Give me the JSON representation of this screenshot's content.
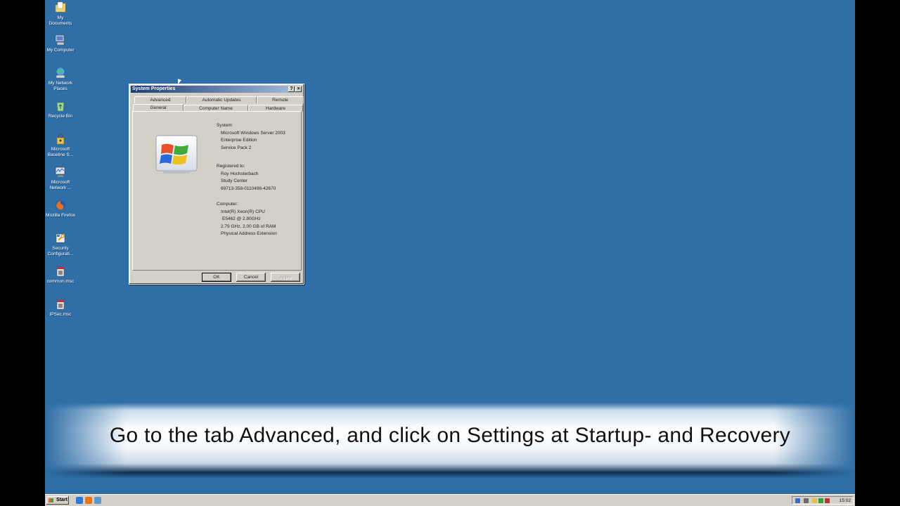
{
  "desktop_icons": [
    {
      "label": "My Documents",
      "icon": "documents-folder-icon"
    },
    {
      "label": "My Computer",
      "icon": "computer-icon"
    },
    {
      "label": "My Network Places",
      "icon": "network-places-icon"
    },
    {
      "label": "Recycle Bin",
      "icon": "recycle-bin-icon"
    },
    {
      "label": "Microsoft Baseline S...",
      "icon": "baseline-analyzer-icon"
    },
    {
      "label": "Microsoft Network ...",
      "icon": "network-monitor-icon"
    },
    {
      "label": "Mozilla Firefox",
      "icon": "firefox-icon"
    },
    {
      "label": "Security Configurati...",
      "icon": "security-config-icon"
    },
    {
      "label": "common.msc",
      "icon": "msc-console-icon"
    },
    {
      "label": "IPSec.msc",
      "icon": "msc-console-icon"
    }
  ],
  "window": {
    "title": "System Properties",
    "help_glyph": "?",
    "close_glyph": "×",
    "tabs_row1": [
      "Advanced",
      "Automatic Updates",
      "Remote"
    ],
    "tabs_row2": [
      "General",
      "Computer Name",
      "Hardware"
    ],
    "active_tab": "General",
    "system": {
      "heading": "System:",
      "lines": [
        "Microsoft Windows Server 2003",
        "Enterprise Edition",
        "Service Pack 2"
      ]
    },
    "registered": {
      "heading": "Registered to:",
      "lines": [
        "Roy Hochsterbach",
        "Study Center",
        "69713-358-0110496-42670"
      ]
    },
    "computer": {
      "heading": "Computer:",
      "lines": [
        "Intel(R) Xeon(R) CPU",
        " E5462  @ 2.80GHz",
        "2.79 GHz, 2.00 GB of RAM",
        "Physical Address Extension"
      ]
    },
    "buttons": {
      "ok": "OK",
      "cancel": "Cancel",
      "apply": "Apply"
    }
  },
  "caption": "Go to the tab Advanced, and click on Settings at Startup- and Recovery",
  "taskbar": {
    "start_label": "Start",
    "clock": "15:02"
  },
  "colors": {
    "desktop": "#2f6ea7",
    "titlebar_start": "#1d3d72",
    "titlebar_end": "#a6c0e0",
    "dialog": "#d4d0c8"
  }
}
